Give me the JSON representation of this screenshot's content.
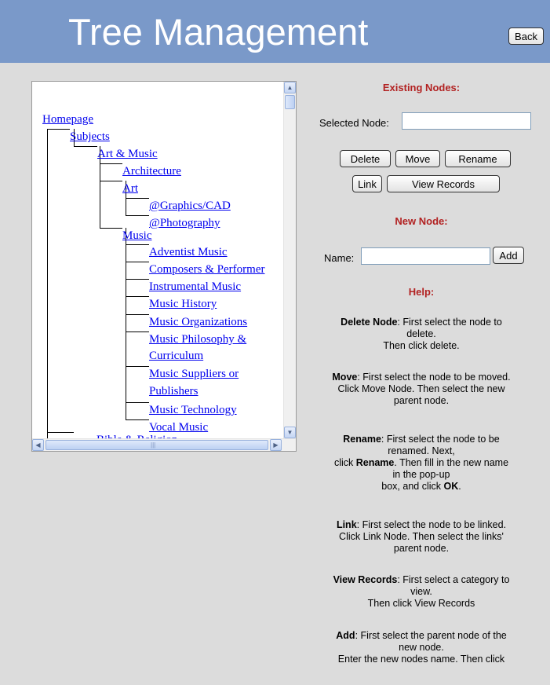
{
  "header": {
    "title": "Tree Management",
    "back_label": "Back"
  },
  "tree": {
    "nodes": [
      "Homepage",
      "Subjects",
      "Art & Music",
      "Architecture",
      "Art",
      "@Graphics/CAD",
      "@Photography",
      "Music",
      "Adventist Music",
      "Composers & Performer",
      "Instrumental Music",
      "Music History",
      "Music Organizations",
      "Music Philosophy &",
      "Curriculum",
      "Music Suppliers or",
      "Publishers",
      "Music Technology",
      "Vocal Music",
      "Bible & Religion"
    ]
  },
  "existing": {
    "heading": "Existing Nodes:",
    "selected_label": "Selected Node:",
    "selected_value": "",
    "buttons": {
      "delete": "Delete",
      "move": "Move",
      "rename": "Rename",
      "link": "Link",
      "view_records": "View Records"
    }
  },
  "new_node": {
    "heading": "New Node:",
    "name_label": "Name:",
    "name_value": "",
    "add_label": "Add"
  },
  "help": {
    "heading": "Help:",
    "delete": {
      "term": "Delete Node",
      "l1": ": First select the node to",
      "l2": "delete.",
      "l3": "Then click delete."
    },
    "move": {
      "term": "Move",
      "l1": ": First select the node to be moved.",
      "l2": "Click Move Node. Then select the new",
      "l3": "parent node."
    },
    "rename": {
      "term": "Rename",
      "l1": ": First select the node to be",
      "l2": "renamed. Next,",
      "l3a": "click ",
      "l3b": "Rename",
      "l3c": ". Then fill in the new name",
      "l4": "in the pop-up",
      "l5a": "box, and click ",
      "l5b": "OK",
      "l5c": "."
    },
    "link": {
      "term": "Link",
      "l1": ": First select the node to be linked.",
      "l2": "Click Link Node. Then select the links'",
      "l3": "parent node."
    },
    "view": {
      "term": "View Records",
      "l1": ": First select a category to",
      "l2": "view.",
      "l3": "Then click View Records"
    },
    "add": {
      "term": "Add",
      "l1": ": First select the parent node of the",
      "l2": "new node.",
      "l3": "Enter the new nodes name. Then click"
    }
  },
  "colors": {
    "header_bg": "#7a99c9",
    "panel_bg": "#dcdcdc",
    "heading": "#b22222",
    "link": "#0000ee"
  }
}
